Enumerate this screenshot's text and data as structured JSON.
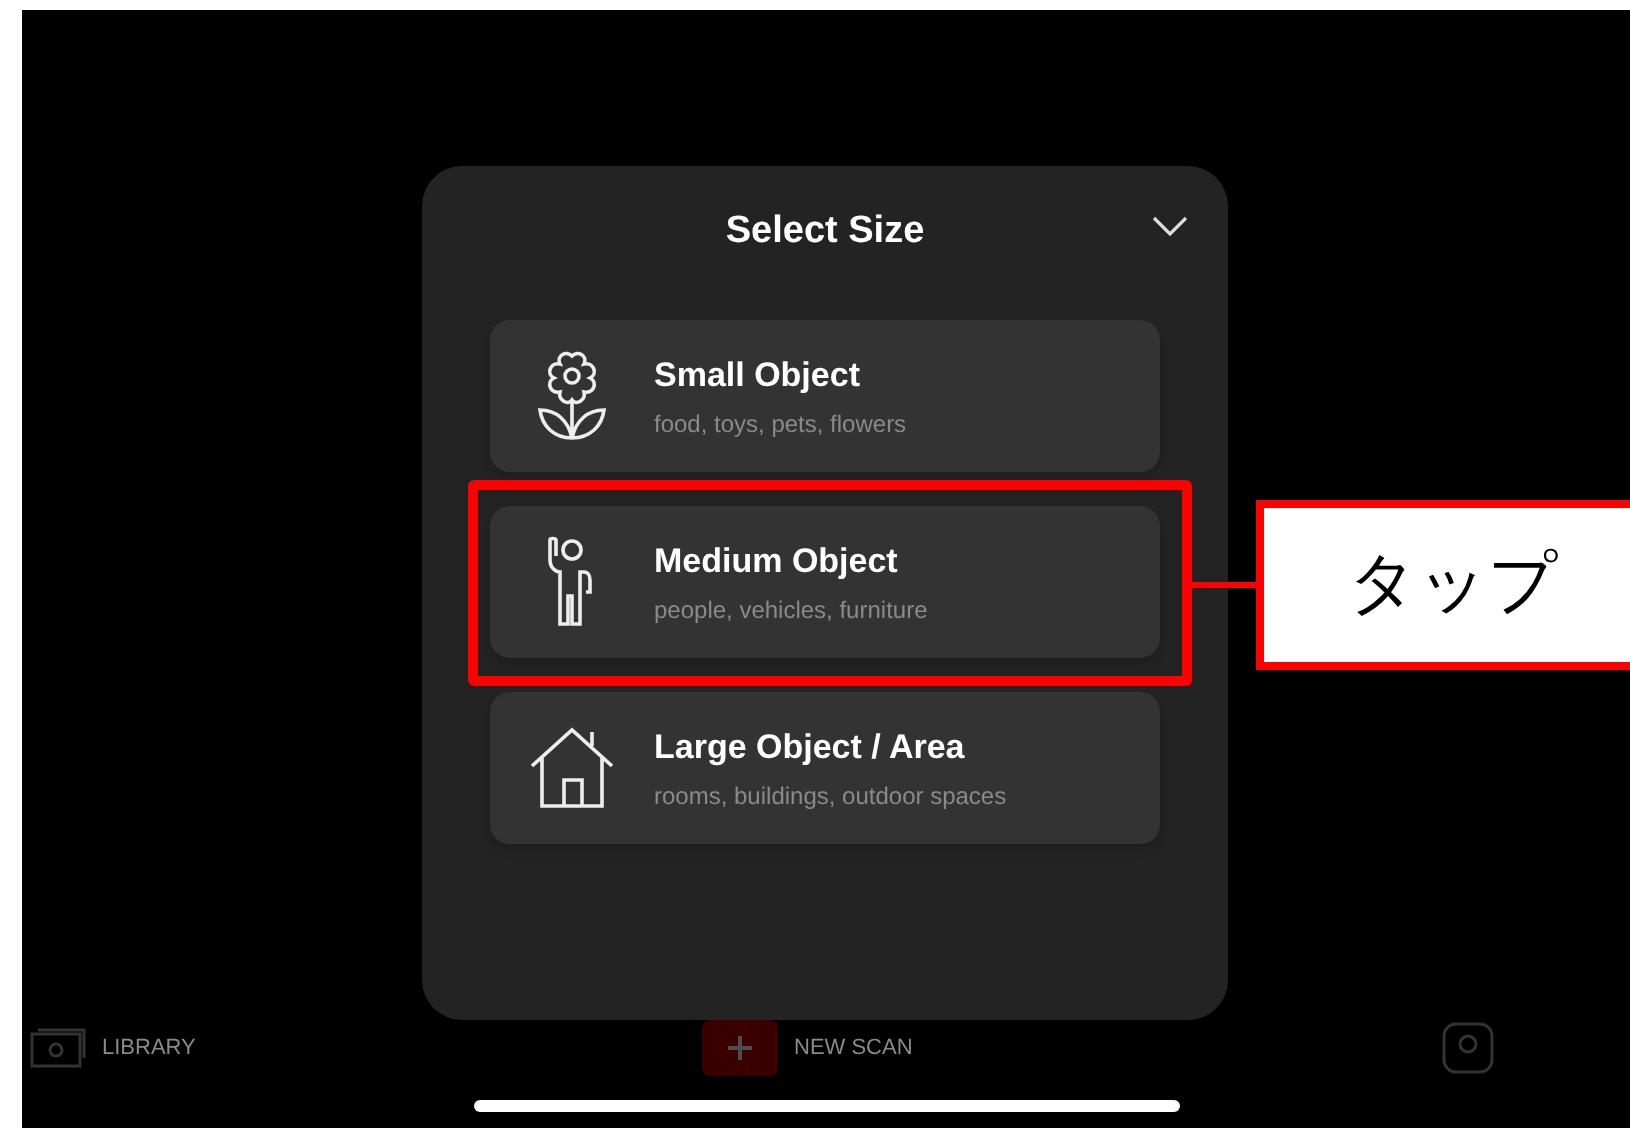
{
  "sheet": {
    "title": "Select Size"
  },
  "options": [
    {
      "kind": "flower",
      "title": "Small Object",
      "subtitle": "food, toys, pets, flowers",
      "highlighted": false
    },
    {
      "kind": "person",
      "title": "Medium Object",
      "subtitle": "people, vehicles, furniture",
      "highlighted": true
    },
    {
      "kind": "house",
      "title": "Large Object / Area",
      "subtitle": "rooms, buildings, outdoor spaces",
      "highlighted": false
    }
  ],
  "callout": {
    "label": "タップ"
  },
  "tab_bar": [
    {
      "kind": "library",
      "label": "LIBRARY"
    },
    {
      "kind": "scan",
      "label": "NEW SCAN"
    },
    {
      "kind": "profile"
    }
  ]
}
